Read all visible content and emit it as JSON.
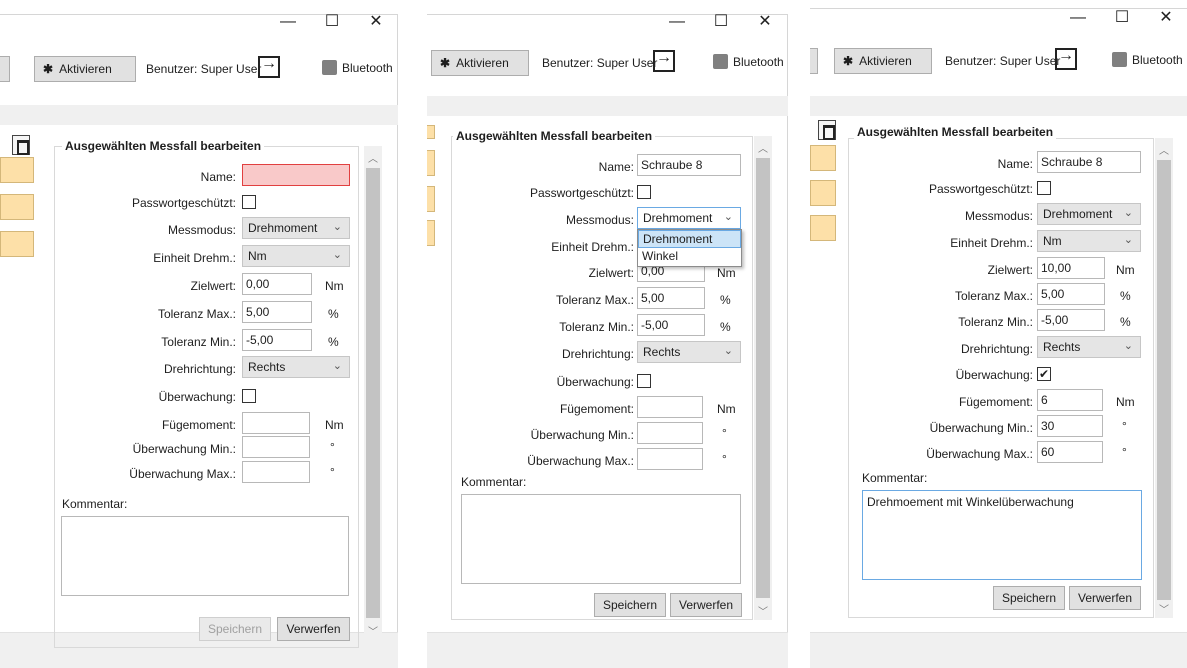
{
  "window_controls": {
    "minimize": "—",
    "maximize": "☐",
    "close": "✕"
  },
  "toolbar": {
    "activate_label": "Aktivieren",
    "user_label": "Benutzer: Super User",
    "bluetooth_label": "Bluetooth"
  },
  "form": {
    "group_title": "Ausgewählten Messfall bearbeiten",
    "labels": {
      "name": "Name:",
      "password": "Passwortgeschützt:",
      "mode": "Messmodus:",
      "unit": "Einheit Drehm.:",
      "target": "Zielwert:",
      "tol_max": "Toleranz Max.:",
      "tol_min": "Toleranz Min.:",
      "direction": "Drehrichtung:",
      "monitoring": "Überwachung:",
      "joint_torque": "Fügemoment:",
      "mon_min": "Überwachung Min.:",
      "mon_max": "Überwachung Max.:",
      "comment": "Kommentar:"
    },
    "units": {
      "nm": "Nm",
      "percent": "%",
      "degree": "°"
    },
    "save_label": "Speichern",
    "discard_label": "Verwerfen"
  },
  "panels": [
    {
      "name": "",
      "password_checked": "",
      "mode": "Drehmoment",
      "unit": "Nm",
      "target": "0,00",
      "tol_max": "5,00",
      "tol_min": "-5,00",
      "direction": "Rechts",
      "monitoring_checked": "",
      "joint_torque": "",
      "mon_min": "",
      "mon_max": "",
      "comment": ""
    },
    {
      "name": "Schraube 8",
      "password_checked": "",
      "mode": "Drehmoment",
      "unit": "",
      "target": "0,00",
      "tol_max": "5,00",
      "tol_min": "-5,00",
      "direction": "Rechts",
      "monitoring_checked": "",
      "joint_torque": "",
      "mon_min": "",
      "mon_max": "",
      "comment": "",
      "dropdown_options": [
        "Drehmoment",
        "Winkel"
      ]
    },
    {
      "name": "Schraube 8",
      "password_checked": "",
      "mode": "Drehmoment",
      "unit": "Nm",
      "target": "10,00",
      "tol_max": "5,00",
      "tol_min": "-5,00",
      "direction": "Rechts",
      "monitoring_checked": "✔",
      "joint_torque": "6",
      "mon_min": "30",
      "mon_max": "60",
      "comment": "Drehmoement mit Winkelüberwachung"
    }
  ]
}
